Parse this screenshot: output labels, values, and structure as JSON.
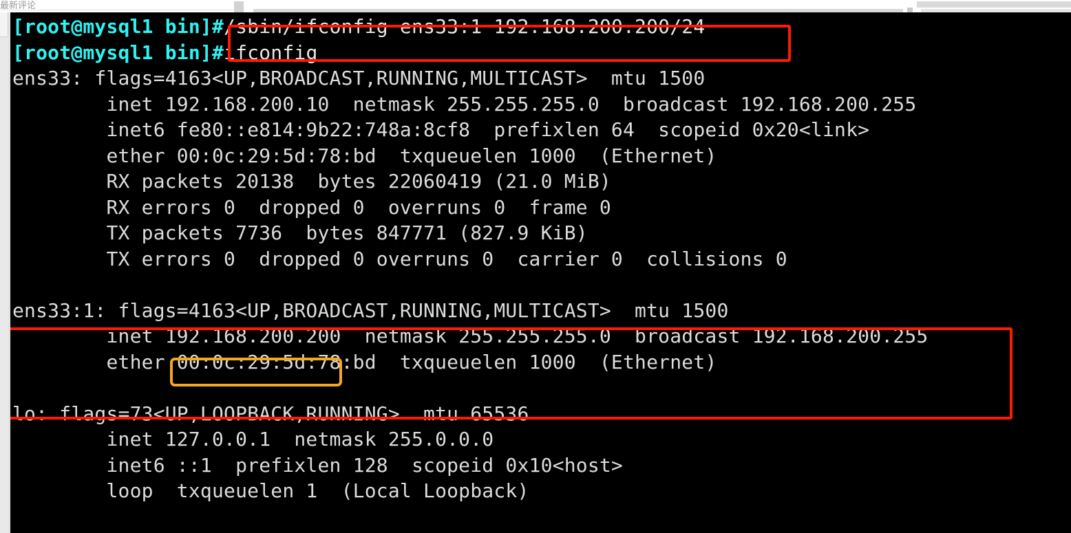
{
  "page_chrome": {
    "label": "最新评论",
    "bars": [
      "bar-a",
      "bar-b",
      "bar-c",
      "bar-d",
      "bar-e"
    ]
  },
  "terminal": {
    "prompt": "[root@mysql1 bin]#",
    "hostname": "mysql1",
    "user": "root",
    "cwd": "bin",
    "colors": {
      "background": "#000000",
      "foreground": "#dcdcdc",
      "prompt": "#2ff3f3",
      "annotation_red": "#ff1a00",
      "annotation_orange": "#f5a623"
    },
    "lines": [
      {
        "type": "command",
        "prompt": "[root@mysql1 bin]#",
        "command": "/sbin/ifconfig ens33:1 192.168.200.200/24"
      },
      {
        "type": "command",
        "prompt": "[root@mysql1 bin]#",
        "command": "ifconfig"
      },
      {
        "type": "output",
        "text": "ens33: flags=4163<UP,BROADCAST,RUNNING,MULTICAST>  mtu 1500"
      },
      {
        "type": "output",
        "text": "        inet 192.168.200.10  netmask 255.255.255.0  broadcast 192.168.200.255"
      },
      {
        "type": "output",
        "text": "        inet6 fe80::e814:9b22:748a:8cf8  prefixlen 64  scopeid 0x20<link>"
      },
      {
        "type": "output",
        "text": "        ether 00:0c:29:5d:78:bd  txqueuelen 1000  (Ethernet)"
      },
      {
        "type": "output",
        "text": "        RX packets 20138  bytes 22060419 (21.0 MiB)"
      },
      {
        "type": "output",
        "text": "        RX errors 0  dropped 0  overruns 0  frame 0"
      },
      {
        "type": "output",
        "text": "        TX packets 7736  bytes 847771 (827.9 KiB)"
      },
      {
        "type": "output",
        "text": "        TX errors 0  dropped 0 overruns 0  carrier 0  collisions 0"
      },
      {
        "type": "blank",
        "text": " "
      },
      {
        "type": "output",
        "text": "ens33:1: flags=4163<UP,BROADCAST,RUNNING,MULTICAST>  mtu 1500"
      },
      {
        "type": "output",
        "text": "        inet 192.168.200.200  netmask 255.255.255.0  broadcast 192.168.200.255"
      },
      {
        "type": "output",
        "text": "        ether 00:0c:29:5d:78:bd  txqueuelen 1000  (Ethernet)"
      },
      {
        "type": "blank",
        "text": " "
      },
      {
        "type": "output",
        "text": "lo: flags=73<UP,LOOPBACK,RUNNING>  mtu 65536"
      },
      {
        "type": "output",
        "text": "        inet 127.0.0.1  netmask 255.0.0.0"
      },
      {
        "type": "output",
        "text": "        inet6 ::1  prefixlen 128  scopeid 0x10<host>"
      },
      {
        "type": "output",
        "text": "        loop  txqueuelen 1  (Local Loopback)"
      }
    ]
  },
  "annotations": {
    "red_box_command": {
      "target": "/sbin/ifconfig ens33:1 192.168.200.200/24",
      "color": "#ff1a00"
    },
    "red_box_interface": {
      "target": "ens33:1 interface block",
      "color": "#ff1a00"
    },
    "orange_box_ip": {
      "target": "192.168.200.200",
      "color": "#f5a623"
    }
  }
}
